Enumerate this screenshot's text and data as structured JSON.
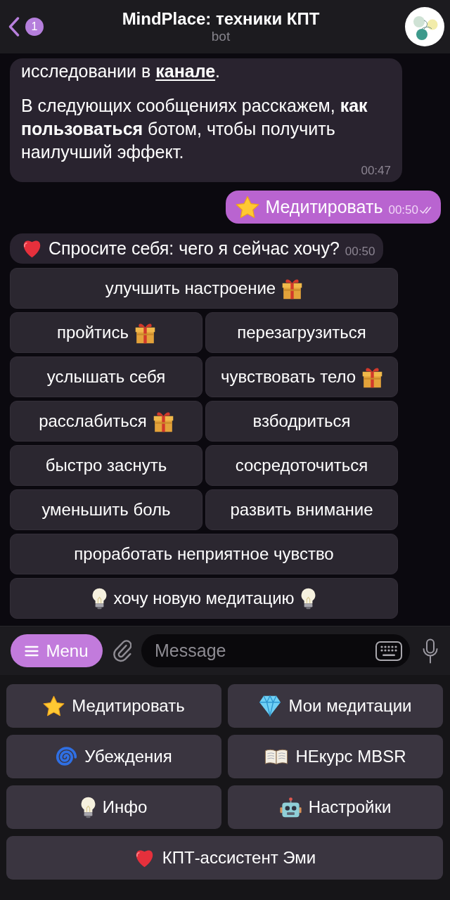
{
  "header": {
    "unread_count": "1",
    "title": "MindPlace: техники КПТ",
    "subtitle": "bot"
  },
  "messages": [
    {
      "outgoing": false,
      "kind": "text",
      "paragraphs": [
        [
          {
            "kind": "text",
            "text": "исследовании в "
          },
          {
            "kind": "link",
            "text": "канале"
          },
          {
            "kind": "text",
            "text": "."
          }
        ],
        [
          {
            "kind": "text",
            "text": "В следующих сообщениях расскажем, **как пользоваться** ботом, чтобы получить наилучший эффект."
          }
        ]
      ],
      "time": "00:47"
    },
    {
      "outgoing": true,
      "kind": "star",
      "paragraphs": [
        [
          {
            "kind": "text",
            "text": "Медитировать"
          }
        ]
      ],
      "time": "00:50",
      "read": true
    },
    {
      "outgoing": false,
      "kind": "heart",
      "paragraphs": [
        [
          {
            "kind": "text",
            "text": "Спросите себя: чего я сейчас хочу?"
          }
        ]
      ],
      "time": "00:50"
    }
  ],
  "inline_keyboard": {
    "rows": [
      [
        {
          "label": "улучшить настроение",
          "kind": "gift"
        }
      ],
      [
        {
          "label": "пройтись",
          "kind": "gift"
        },
        {
          "label": "перезагрузиться",
          "kind": "plain"
        }
      ],
      [
        {
          "label": "услышать себя",
          "kind": "plain"
        },
        {
          "label": "чувствовать тело",
          "kind": "gift"
        }
      ],
      [
        {
          "label": "расслабиться",
          "kind": "gift"
        },
        {
          "label": "взбодриться",
          "kind": "plain"
        }
      ],
      [
        {
          "label": "быстро заснуть",
          "kind": "plain"
        },
        {
          "label": "сосредоточиться",
          "kind": "plain"
        }
      ],
      [
        {
          "label": "уменьшить боль",
          "kind": "plain"
        },
        {
          "label": "развить внимание",
          "kind": "plain"
        }
      ],
      [
        {
          "label": "проработать неприятное чувство",
          "kind": "plain"
        }
      ],
      [
        {
          "label": "хочу новую медитацию",
          "kind": "bulbs"
        }
      ]
    ]
  },
  "composer": {
    "menu_button": "Menu",
    "placeholder": "Message"
  },
  "reply_keyboard": {
    "rows": [
      [
        {
          "label": "Медитировать",
          "kind": "star"
        },
        {
          "label": "Мои медитации",
          "kind": "diamond"
        }
      ],
      [
        {
          "label": "Убеждения",
          "kind": "spiral"
        },
        {
          "label": "НЕкурс MBSR",
          "kind": "book"
        }
      ],
      [
        {
          "label": "Инфо",
          "kind": "bulb"
        },
        {
          "label": "Настройки",
          "kind": "robot"
        }
      ],
      [
        {
          "label": "КПТ-ассистент Эми",
          "kind": "heart"
        }
      ]
    ]
  }
}
